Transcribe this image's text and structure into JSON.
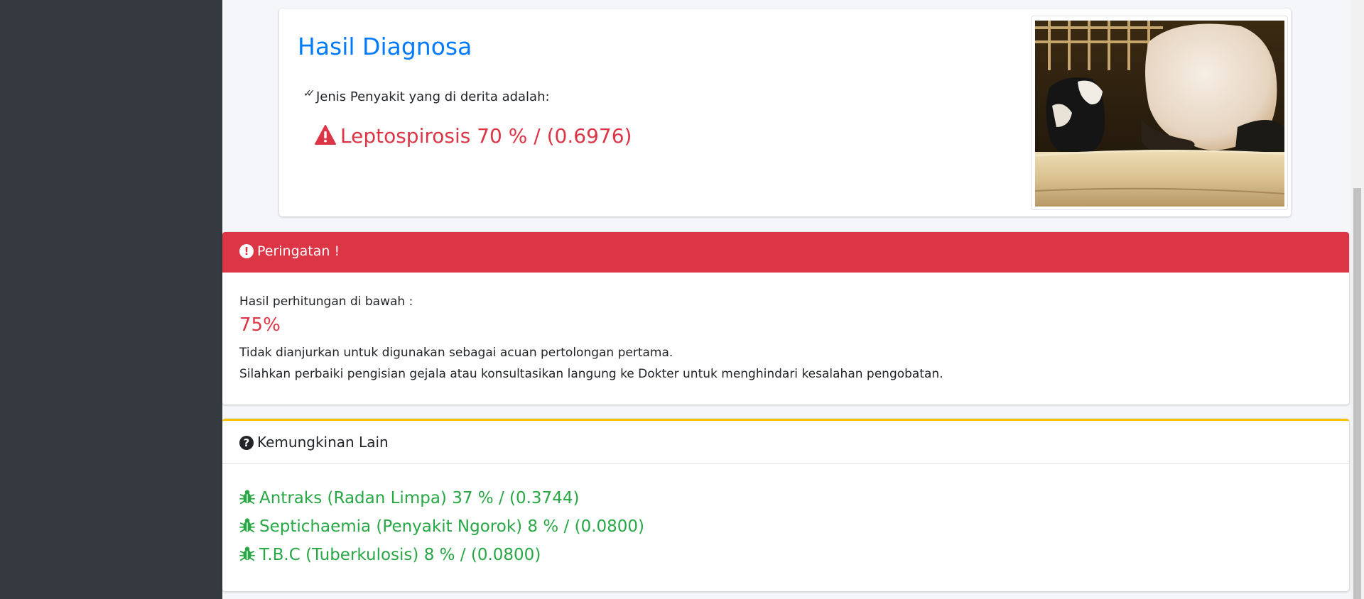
{
  "result": {
    "title": "Hasil Diagnosa",
    "subtitle": "Jenis Penyakit yang di derita adalah:",
    "disease": "Leptospirosis 70 % / (0.6976)"
  },
  "warning": {
    "title": "Peringatan !",
    "calc_label": "Hasil perhitungan di bawah :",
    "calc_value": "75%",
    "line1": "Tidak dianjurkan untuk digunakan sebagai acuan pertolongan pertama.",
    "line2": "Silahkan perbaiki pengisian gejala atau konsultasikan langung ke Dokter untuk menghindari kesalahan pengobatan."
  },
  "others": {
    "title": "Kemungkinan Lain",
    "items": [
      "Antraks (Radan Limpa) 37 % / (0.3744)",
      "Septichaemia (Penyakit Ngorok) 8 % / (0.0800)",
      "T.B.C (Tuberkulosis) 8 % / (0.0800)"
    ]
  },
  "icons": {
    "check": "double-check-icon",
    "warning": "exclamation-triangle-icon",
    "alert": "exclamation-circle-icon",
    "question": "question-circle-icon",
    "bug": "bug-icon"
  },
  "colors": {
    "primary": "#007bff",
    "danger": "#dc3545",
    "success": "#28a745",
    "warning": "#ffc107",
    "sidebar": "#343a40"
  }
}
